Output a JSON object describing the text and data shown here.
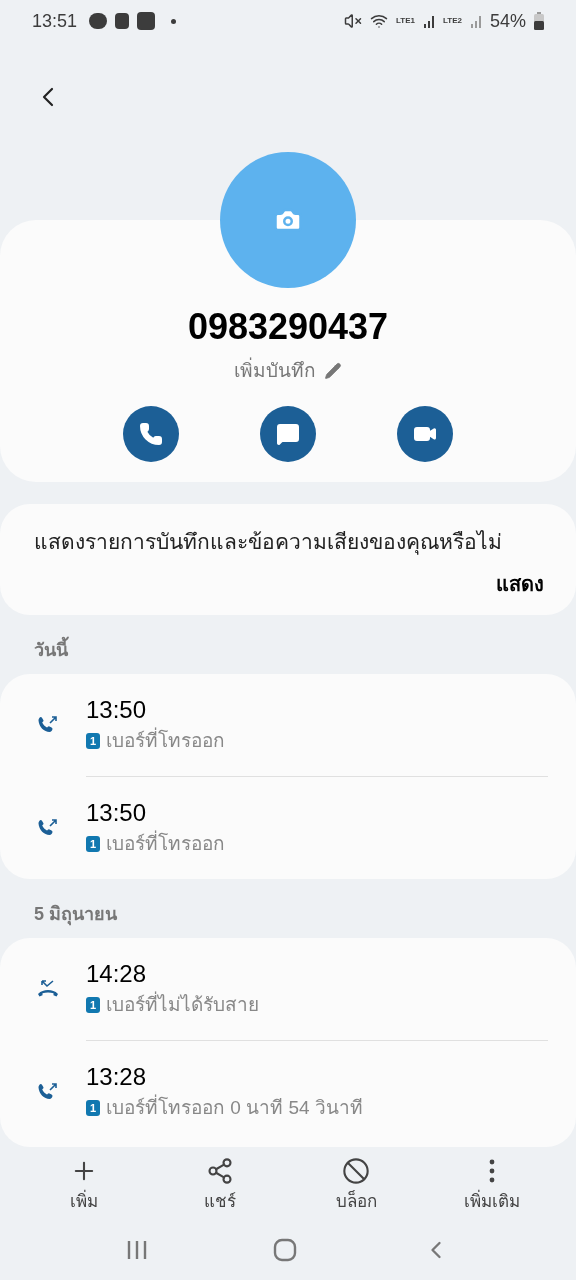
{
  "status_bar": {
    "time": "13:51",
    "network_1": "LTE1",
    "network_2": "LTE2",
    "battery": "54%"
  },
  "contact": {
    "number": "0983290437",
    "note_label": "เพิ่มบันทึก"
  },
  "actions": [
    {
      "kind": "call"
    },
    {
      "kind": "message"
    },
    {
      "kind": "video"
    }
  ],
  "banner": {
    "text": "แสดงรายการบันทึกและข้อความเสียงของคุณหรือไม่",
    "button": "แสดง"
  },
  "groups": [
    {
      "header": "วันนี้",
      "calls": [
        {
          "kind": "outgoing",
          "time": "13:50",
          "sim": "1",
          "detail": "เบอร์ที่โทรออก"
        },
        {
          "kind": "outgoing",
          "time": "13:50",
          "sim": "1",
          "detail": "เบอร์ที่โทรออก"
        }
      ]
    },
    {
      "header": "5 มิถุนายน",
      "calls": [
        {
          "kind": "missed",
          "time": "14:28",
          "sim": "1",
          "detail": "เบอร์ที่ไม่ได้รับสาย"
        },
        {
          "kind": "outgoing",
          "time": "13:28",
          "sim": "1",
          "detail": "เบอร์ที่โทรออก 0 นาที 54 วินาที"
        }
      ]
    }
  ],
  "bottom_actions": [
    {
      "kind": "add",
      "label": "เพิ่ม"
    },
    {
      "kind": "share",
      "label": "แชร์"
    },
    {
      "kind": "block",
      "label": "บล็อก"
    },
    {
      "kind": "more",
      "label": "เพิ่มเติม"
    }
  ]
}
